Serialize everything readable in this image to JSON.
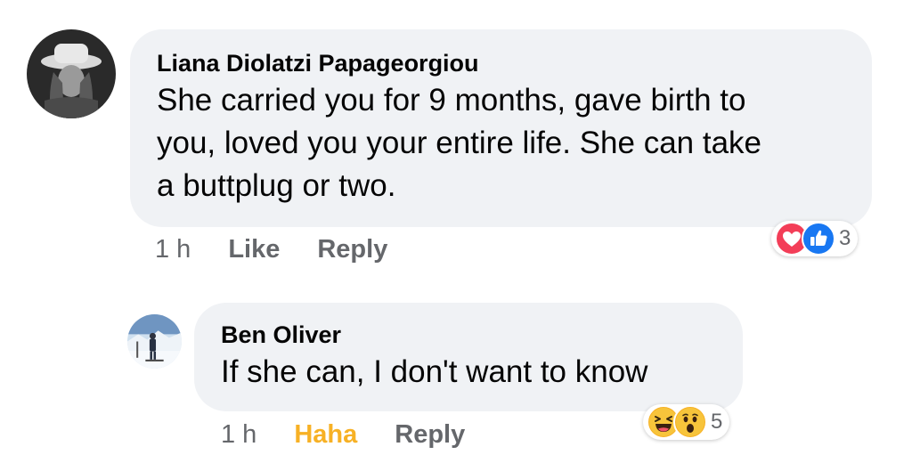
{
  "comments": [
    {
      "author": "Liana Diolatzi Papageorgiou",
      "text_lines": [
        "She carried you for 9 months, gave birth to",
        "you, loved you your entire life. She can take",
        "a buttplug or two."
      ],
      "time": "1 h",
      "like_label": "Like",
      "reply_label": "Reply",
      "reactions": {
        "icons": [
          "love-icon",
          "like-icon"
        ],
        "count": "3"
      }
    },
    {
      "author": "Ben Oliver",
      "text_lines": [
        "If she can, I don't want to know"
      ],
      "time": "1 h",
      "like_label": "Haha",
      "reply_label": "Reply",
      "reactions": {
        "icons": [
          "haha-icon",
          "wow-icon"
        ],
        "count": "5"
      }
    }
  ],
  "colors": {
    "bubble": "#f0f2f5",
    "secondary_text": "#65676b",
    "haha_reaction": "#f7b125",
    "love": "#f33e58",
    "like": "#1877f2"
  }
}
